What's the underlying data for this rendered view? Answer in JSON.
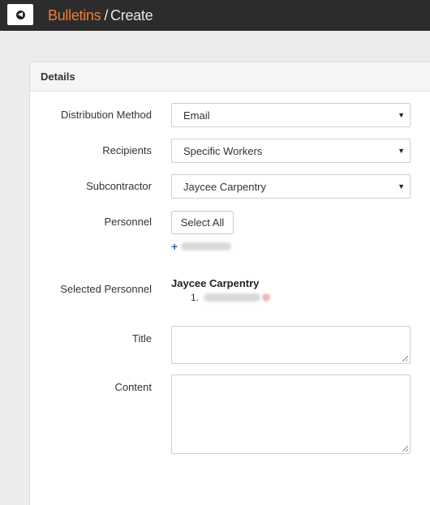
{
  "header": {
    "back_icon": "back-arrow-icon",
    "breadcrumb_link": "Bulletins",
    "breadcrumb_separator": "/",
    "breadcrumb_current": "Create",
    "accent_color": "#f07c34"
  },
  "panel": {
    "title": "Details"
  },
  "form": {
    "distribution_method": {
      "label": "Distribution Method",
      "value": "Email"
    },
    "recipients": {
      "label": "Recipients",
      "value": "Specific Workers"
    },
    "subcontractor": {
      "label": "Subcontractor",
      "value": "Jaycee Carpentry"
    },
    "personnel": {
      "label": "Personnel",
      "select_all_label": "Select All",
      "add_icon": "plus-icon"
    },
    "selected_personnel": {
      "label": "Selected Personnel",
      "group_name": "Jaycee Carpentry",
      "items": [
        {
          "number": "1."
        }
      ]
    },
    "title": {
      "label": "Title",
      "value": ""
    },
    "content": {
      "label": "Content",
      "value": ""
    }
  }
}
